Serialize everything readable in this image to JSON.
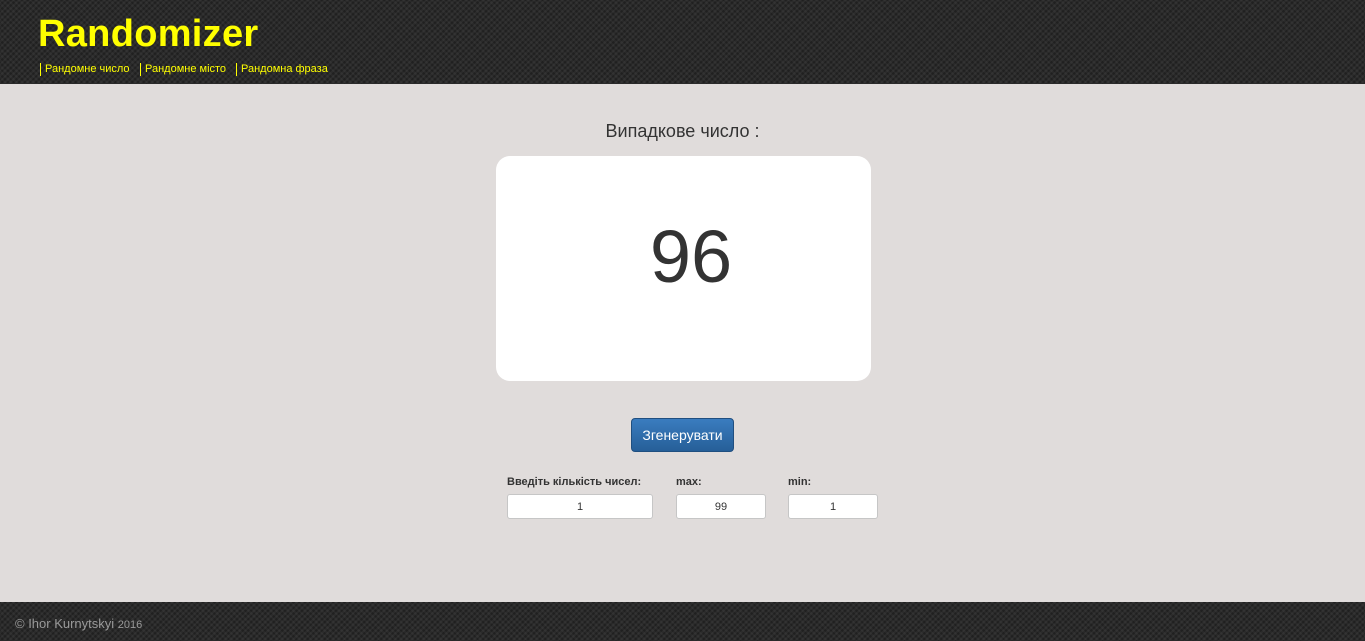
{
  "header": {
    "logo": "Randomizer",
    "nav": [
      {
        "label": "Рандомне число"
      },
      {
        "label": "Рандомне місто"
      },
      {
        "label": "Рандомна фраза"
      }
    ]
  },
  "main": {
    "label": "Випадкове число :",
    "result": "96",
    "generate_label": "Згенерувати",
    "fields": {
      "count": {
        "label": "Введіть кількість чисел:",
        "value": "1"
      },
      "max": {
        "label": "max:",
        "value": "99"
      },
      "min": {
        "label": "min:",
        "value": "1"
      }
    }
  },
  "footer": {
    "copyright": "© Ihor Kurnytskyi",
    "year": "2016"
  }
}
